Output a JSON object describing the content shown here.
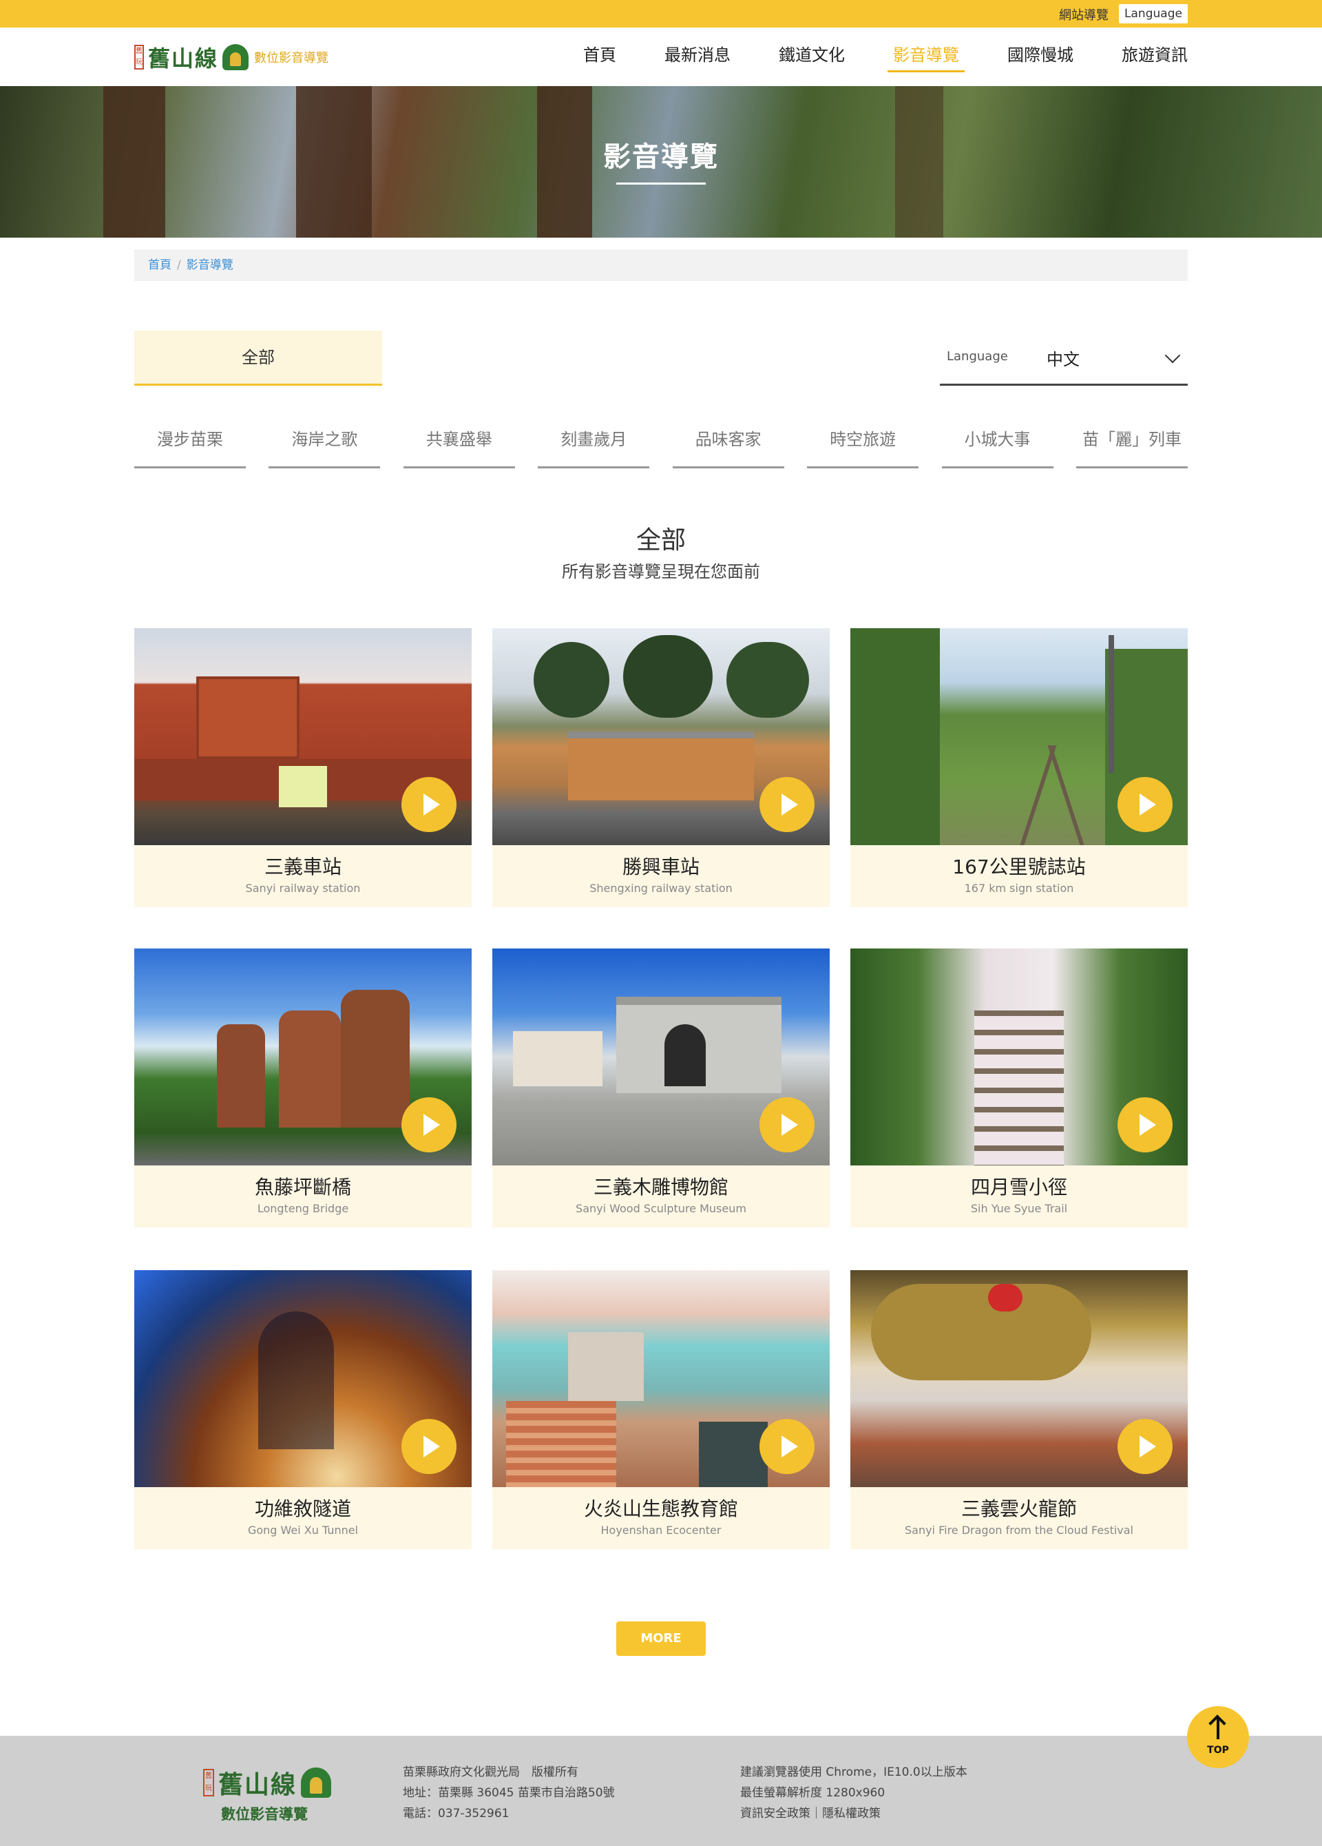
{
  "topbar": {
    "sitemap": "網站導覽",
    "language": "Language"
  },
  "header": {
    "logo": {
      "seal": "舊玩",
      "name": "舊山線",
      "subtitle": "數位影音導覽"
    },
    "nav": [
      "首頁",
      "最新消息",
      "鐵道文化",
      "影音導覽",
      "國際慢城",
      "旅遊資訊"
    ],
    "active_nav": "影音導覽"
  },
  "banner": {
    "title": "影音導覽"
  },
  "breadcrumb": {
    "home": "首頁",
    "current": "影音導覽",
    "separator": "/"
  },
  "filters": {
    "all_tab": "全部",
    "language_label": "Language",
    "language_value": "中文",
    "categories": [
      "漫步苗栗",
      "海岸之歌",
      "共襄盛舉",
      "刻畫歲月",
      "品味客家",
      "時空旅遊",
      "小城大事",
      "苗「麗」列車"
    ]
  },
  "section": {
    "title": "全部",
    "subtitle": "所有影音導覽呈現在您面前"
  },
  "videos": [
    {
      "zh": "三義車站",
      "en": "Sanyi railway station"
    },
    {
      "zh": "勝興車站",
      "en": "Shengxing railway station"
    },
    {
      "zh": "167公里號誌站",
      "en": "167 km sign station"
    },
    {
      "zh": "魚藤坪斷橋",
      "en": "Longteng Bridge"
    },
    {
      "zh": "三義木雕博物館",
      "en": "Sanyi Wood Sculpture Museum"
    },
    {
      "zh": "四月雪小徑",
      "en": "Sih Yue Syue Trail"
    },
    {
      "zh": "功維敘隧道",
      "en": "Gong Wei Xu Tunnel"
    },
    {
      "zh": "火炎山生態教育館",
      "en": "Hoyenshan Ecocenter"
    },
    {
      "zh": "三義雲火龍節",
      "en": "Sanyi Fire Dragon from the Cloud Festival"
    }
  ],
  "more_button": "MORE",
  "top_button": "TOP",
  "footer": {
    "logo": {
      "seal": "舊玩",
      "name": "舊山線",
      "subtitle": "數位影音導覽"
    },
    "col1": [
      "苗栗縣政府文化觀光局　版權所有",
      "地址：苗栗縣 36045 苗栗市自治路50號",
      "電話：037-352961"
    ],
    "col2": [
      "建議瀏覽器使用 Chrome，IE10.0以上版本",
      "最佳螢幕解析度 1280x960",
      "資訊安全政策｜隱私權政策"
    ]
  },
  "colors": {
    "accent": "#f7c52f",
    "brand_green": "#2e6b2e",
    "card_bg": "#fdf7e4",
    "footer_bg": "#cfcfcf"
  }
}
